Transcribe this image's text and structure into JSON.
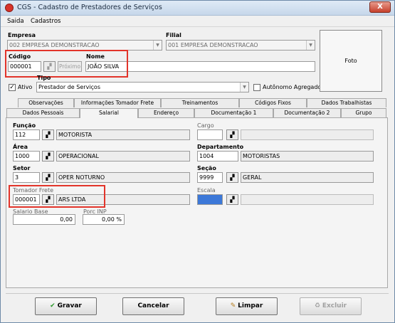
{
  "window": {
    "title": "CGS - Cadastro de Prestadores de Serviços",
    "close_label": "X"
  },
  "menu": {
    "items": [
      "Saida",
      "Cadastros"
    ]
  },
  "empresa": {
    "label": "Empresa",
    "value": "002 EMPRESA DEMONSTRACAO"
  },
  "filial": {
    "label": "Filial",
    "value": "001 EMPRESA DEMONSTRACAO"
  },
  "codigo": {
    "label": "Código",
    "value": "000001",
    "proximo_label": "Próximo"
  },
  "nome": {
    "label": "Nome",
    "value": "JOÃO SILVA"
  },
  "ativo": {
    "label": "Ativo",
    "checked_mark": "✓"
  },
  "tipo": {
    "label": "Tipo",
    "value": "Prestador de Serviços"
  },
  "autonomo": {
    "label": "Autônomo Agregado"
  },
  "foto": {
    "label": "Foto"
  },
  "tabs": {
    "row1": [
      "Observações",
      "Informações Tomador Frete",
      "Treinamentos",
      "Códigos Fixos",
      "Dados Trabalhistas"
    ],
    "row2": [
      "Dados Pessoais",
      "Salarial",
      "Endereço",
      "Documentação 1",
      "Documentação 2",
      "Grupo"
    ]
  },
  "fields": {
    "funcao": {
      "label": "Função",
      "code": "112",
      "desc": "MOTORISTA"
    },
    "cargo": {
      "label": "Cargo",
      "code": "",
      "desc": ""
    },
    "area": {
      "label": "Área",
      "code": "1000",
      "desc": "OPERACIONAL"
    },
    "departamento": {
      "label": "Departamento",
      "code": "1004",
      "desc": "MOTORISTAS"
    },
    "setor": {
      "label": "Setor",
      "code": "3",
      "desc": "OPER NOTURNO"
    },
    "secao": {
      "label": "Seção",
      "code": "9999",
      "desc": "GERAL"
    },
    "tomador": {
      "label": "Tomador Frete",
      "code": "000001",
      "desc": "ARS LTDA"
    },
    "escala": {
      "label": "Escala",
      "code": "",
      "desc": ""
    },
    "salario": {
      "label": "Salario Base",
      "value": "0,00"
    },
    "porc_inp": {
      "label": "Porc INP",
      "value": "0,00 %"
    }
  },
  "buttons": {
    "gravar": "Gravar",
    "cancelar": "Cancelar",
    "limpar": "Limpar",
    "excluir": "Excluir"
  },
  "colors": {
    "highlight": "#e2342a",
    "accent_blue": "#3c78d8"
  }
}
